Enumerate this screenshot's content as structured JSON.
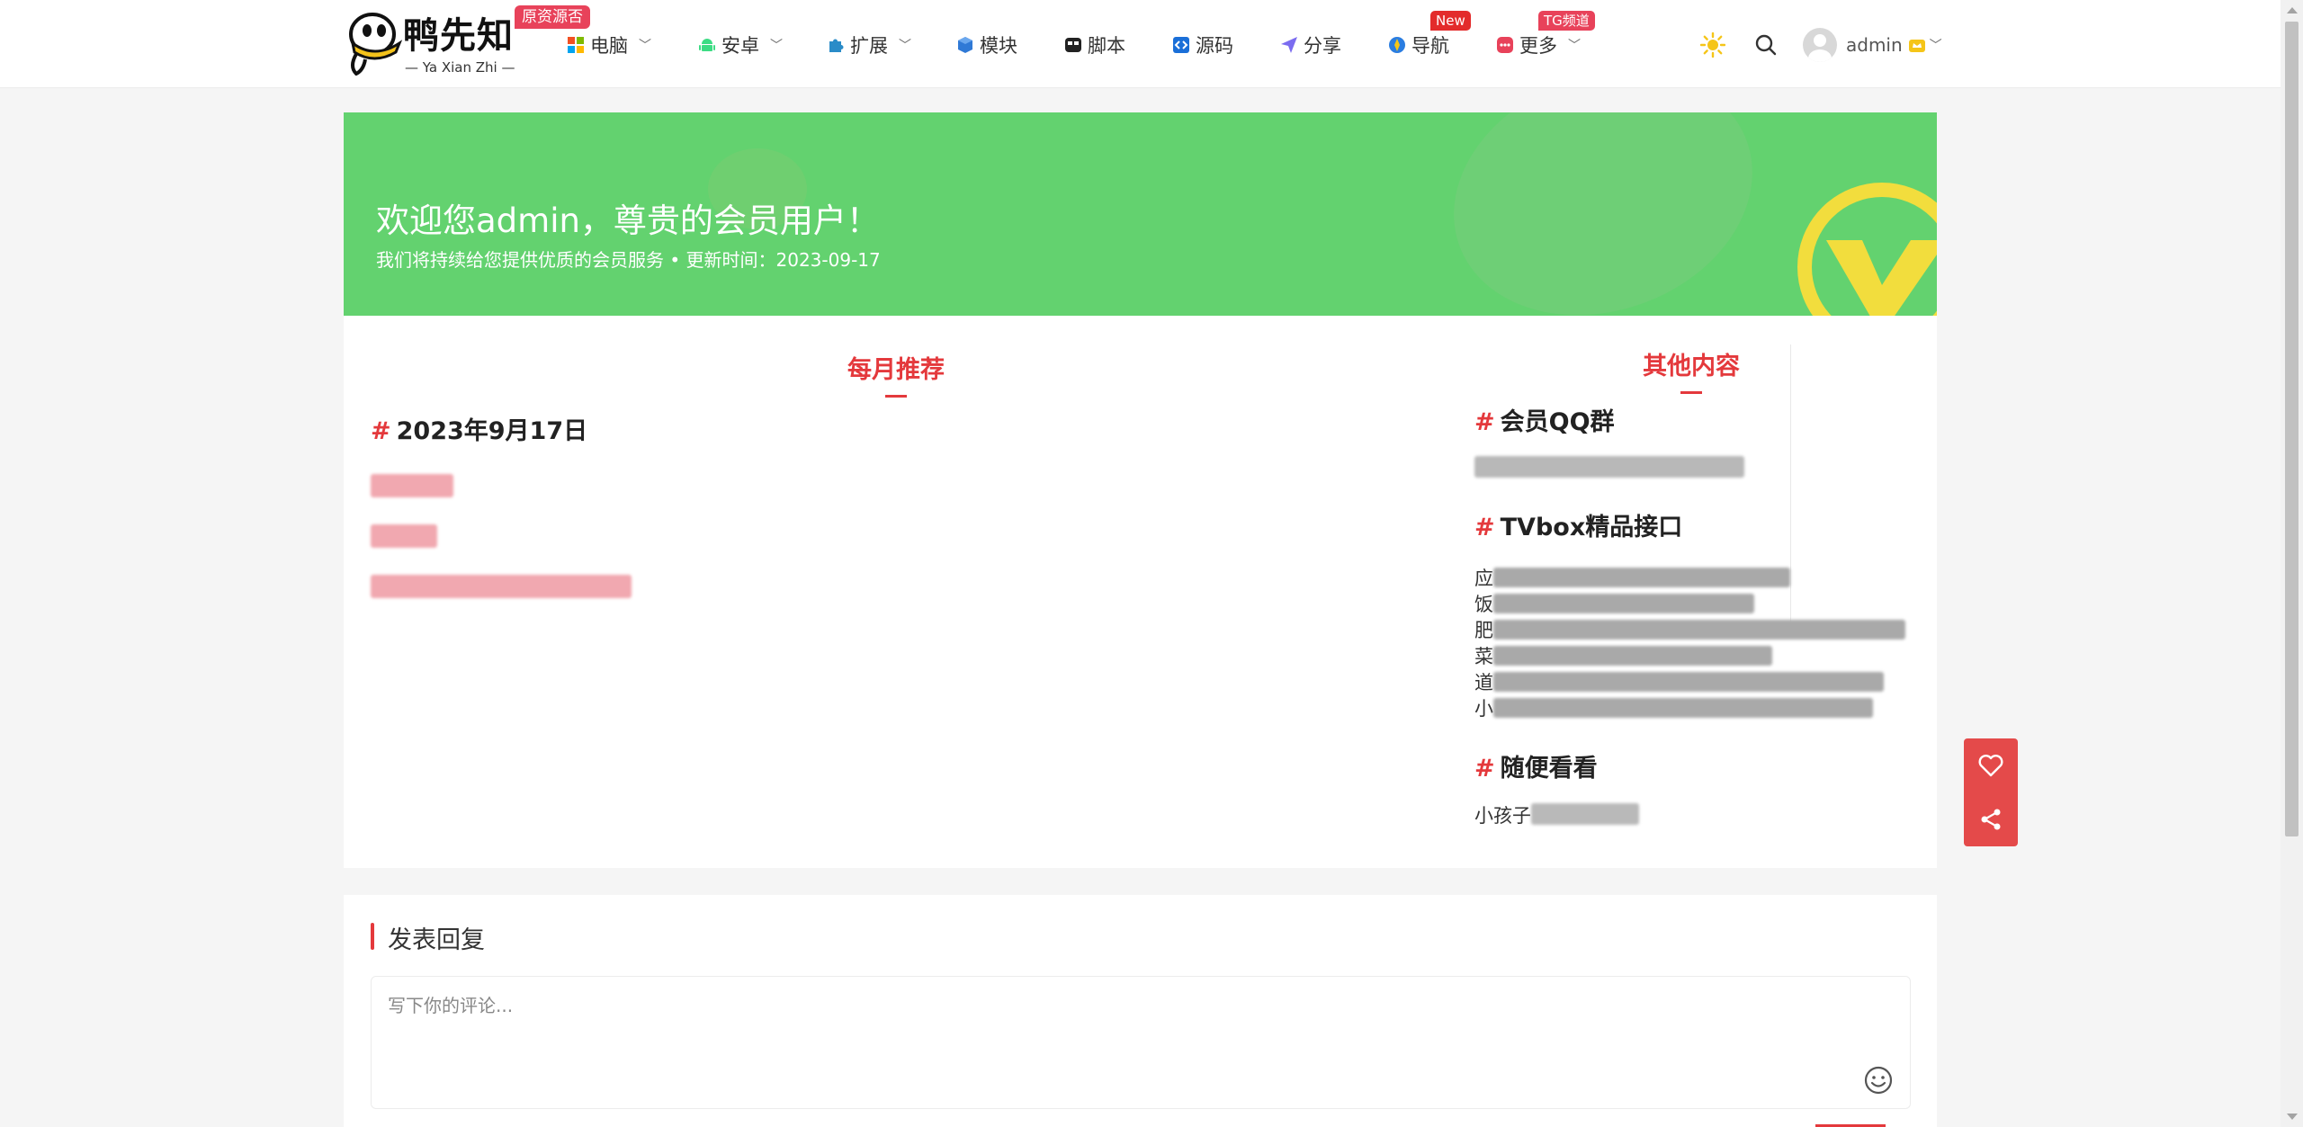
{
  "header": {
    "logo_text": "鸭先知",
    "logo_sub": "— Ya Xian Zhi —",
    "logo_badge": "原资源否",
    "nav": [
      {
        "label": "电脑",
        "icon": "windows-icon",
        "dropdown": true
      },
      {
        "label": "安卓",
        "icon": "android-icon",
        "dropdown": true
      },
      {
        "label": "扩展",
        "icon": "puzzle-icon",
        "dropdown": true
      },
      {
        "label": "模块",
        "icon": "cube-icon",
        "dropdown": false
      },
      {
        "label": "脚本",
        "icon": "script-icon",
        "dropdown": false
      },
      {
        "label": "源码",
        "icon": "code-icon",
        "dropdown": false
      },
      {
        "label": "分享",
        "icon": "send-icon",
        "dropdown": false
      },
      {
        "label": "导航",
        "icon": "compass-icon",
        "dropdown": false,
        "badge": "New"
      },
      {
        "label": "更多",
        "icon": "more-icon",
        "dropdown": true,
        "badge": "TG频道"
      }
    ],
    "user": {
      "name": "admin"
    }
  },
  "banner": {
    "title": "欢迎您admin，尊贵的会员用户！",
    "subtitle": "我们将持续给您提供优质的会员服务 • 更新时间：2023-09-17"
  },
  "left": {
    "section_title": "每月推荐",
    "date_heading": "2023年9月17日"
  },
  "right": {
    "section_title": "其他内容",
    "qq_heading": "会员QQ群",
    "tvbox_heading": "TVbox精品接口",
    "tvbox_prefixes": [
      "应",
      "饭",
      "肥",
      "菜",
      "道",
      "小"
    ],
    "random_heading": "随便看看",
    "random_prefix": "小孩子"
  },
  "reply": {
    "title": "发表回复",
    "placeholder": "写下你的评论..."
  },
  "colors": {
    "accent": "#e4393c",
    "banner_green": "#63d26f",
    "float_red": "#e44a4a"
  }
}
